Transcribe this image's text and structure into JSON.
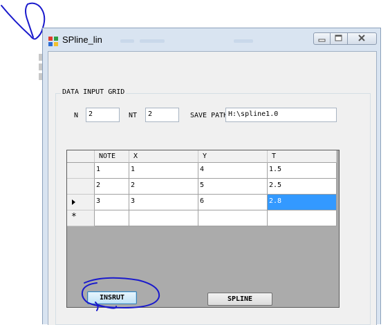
{
  "window": {
    "title": "SPline_lin"
  },
  "group": {
    "title": "DATA INPUT GRID"
  },
  "fields": {
    "n_label": "N",
    "n_value": "2",
    "nt_label": "NT",
    "nt_value": "2",
    "save_path_label": "SAVE PATH",
    "save_path_value": "H:\\spline1.0"
  },
  "grid": {
    "columns": [
      "NOTE",
      "X",
      "Y",
      "T"
    ],
    "rows": [
      [
        "1",
        "1",
        "4",
        "1.5"
      ],
      [
        "2",
        "2",
        "5",
        "2.5"
      ],
      [
        "3",
        "3",
        "6",
        "2.8"
      ]
    ],
    "current_row_index": 2,
    "selected_cell": "2.8",
    "new_row_marker": "*"
  },
  "buttons": {
    "insert_label": "INSRUT",
    "spline_label": "SPLINE"
  },
  "colors": {
    "selection": "#3399ff",
    "grid_background": "#ababab",
    "annotation_ink": "#1a1acc"
  },
  "icons": {
    "app": "app-window-icon",
    "minimize": "minimize-icon",
    "maximize": "maximize-icon",
    "close": "close-icon",
    "current_row": "row-pointer-icon"
  }
}
